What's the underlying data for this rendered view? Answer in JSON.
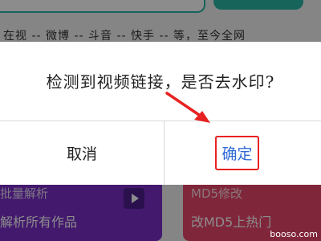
{
  "background": {
    "text_row": "在视 -- 微博 -- 斗音 -- 快手 -- 等，至今全网",
    "left_card": {
      "line1": "批量解析",
      "line2": "解析所有作品"
    },
    "right_card": {
      "line1": "MD5修改",
      "line2": "改MD5上热门"
    }
  },
  "dialog": {
    "message": "检测到视频链接，是否去水印?",
    "cancel_label": "取消",
    "confirm_label": "确定"
  },
  "watermark": "booso.com",
  "colors": {
    "confirm_text": "#2f6bd8",
    "highlight_box": "#e82222",
    "arrow": "#e82222",
    "left_card": "#7a2fc9",
    "right_card": "#e9466c",
    "teal": "#2bb6a6"
  }
}
